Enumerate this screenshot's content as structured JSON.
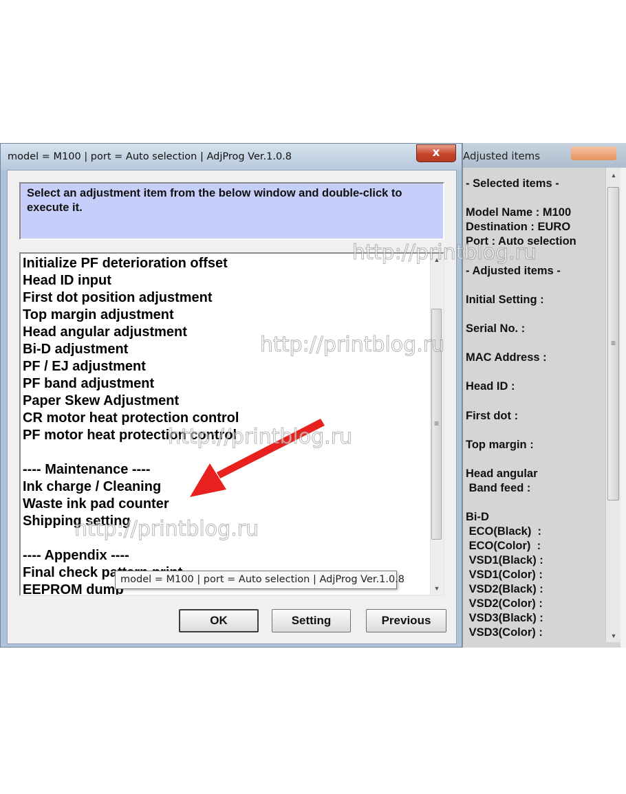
{
  "dialog": {
    "title": "model = M100 | port = Auto selection | AdjProg Ver.1.0.8",
    "close_label": "x",
    "instruction": "Select an adjustment item from the below window and double-click to execute it.",
    "list_items": [
      "Initialize PF deterioration offset",
      "Head ID input",
      "First dot position adjustment",
      "Top margin adjustment",
      "Head angular adjustment",
      "Bi-D adjustment",
      "PF / EJ adjustment",
      "PF band adjustment",
      "Paper Skew Adjustment",
      "CR motor heat protection control",
      "PF motor heat protection control",
      "",
      "---- Maintenance ----",
      "Ink charge / Cleaning",
      "Waste ink pad counter",
      "Shipping setting",
      "",
      "---- Appendix ----",
      "Final check pattern print",
      "EEPROM dump"
    ],
    "buttons": {
      "ok": "OK",
      "setting": "Setting",
      "previous": "Previous"
    },
    "tooltip": "model = M100 | port = Auto selection | AdjProg Ver.1.0.8"
  },
  "panel": {
    "title": "Adjusted items",
    "lines": [
      "- Selected items -",
      "Model Name : M100",
      "Destination : EURO",
      "Port : Auto selection",
      "- Adjusted items -",
      "Initial Setting :",
      "Serial No. :",
      "MAC Address :",
      "Head ID :",
      "First dot :",
      "Top margin :",
      "Head angular",
      " Band feed :",
      "Bi-D",
      " ECO(Black)  :",
      " ECO(Color)  :",
      " VSD1(Black) :",
      " VSD1(Color) :",
      " VSD2(Black) :",
      " VSD2(Color) :",
      " VSD3(Black) :",
      " VSD3(Color) :"
    ]
  },
  "watermark": "http://printblog.ru",
  "colors": {
    "instruction_bg": "#c6cff9",
    "arrow": "#e8211e",
    "close_button": "#c4442a"
  }
}
